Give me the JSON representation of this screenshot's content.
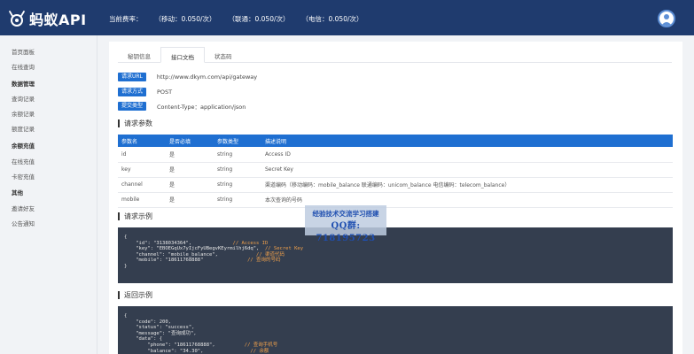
{
  "header": {
    "logo_text": "蚂蚁API",
    "rates": [
      {
        "label": "当前费率：",
        "value": ""
      },
      {
        "label": "（移动：0.050/次）",
        "value": ""
      },
      {
        "label": "（联通：0.050/次）",
        "value": ""
      },
      {
        "label": "（电信：0.050/次）",
        "value": ""
      }
    ],
    "avatar_icon": "user-avatar-icon"
  },
  "sidebar": {
    "items": [
      {
        "label": "首页面板",
        "group": false
      },
      {
        "label": "在线查询",
        "group": false
      },
      {
        "label": "数据管理",
        "group": true
      },
      {
        "label": "查询记录",
        "group": false
      },
      {
        "label": "余额记录",
        "group": false
      },
      {
        "label": "额度记录",
        "group": false
      },
      {
        "label": "余额充值",
        "group": true
      },
      {
        "label": "在线充值",
        "group": false
      },
      {
        "label": "卡密充值",
        "group": false
      },
      {
        "label": "其他",
        "group": true
      },
      {
        "label": "邀请好友",
        "group": false
      },
      {
        "label": "公告通知",
        "group": false
      }
    ]
  },
  "tabs": [
    {
      "label": "秘钥信息",
      "active": false
    },
    {
      "label": "接口文档",
      "active": true
    },
    {
      "label": "状态码",
      "active": false
    }
  ],
  "request_info": [
    {
      "badge": "请求URL",
      "value": "http://www.dkym.com/api/gateway"
    },
    {
      "badge": "请求方式",
      "value": "POST"
    },
    {
      "badge": "提交类型",
      "value": "Content-Type：application/json"
    }
  ],
  "sections": {
    "params_title": "请求参数",
    "example_title": "请求示例",
    "response_title": "返回示例"
  },
  "param_table": {
    "headers": [
      "参数名",
      "是否必填",
      "参数类型",
      "描述说明"
    ],
    "rows": [
      [
        "id",
        "是",
        "string",
        "Access ID"
      ],
      [
        "key",
        "是",
        "string",
        "Secret Key"
      ],
      [
        "channel",
        "是",
        "string",
        "渠道编码（移动编码：mobile_balance 联通编码：unicom_balance 电信编码：telecom_balance）"
      ],
      [
        "mobile",
        "是",
        "string",
        "本次查询的号码"
      ]
    ]
  },
  "request_example": [
    {
      "code": "{",
      "comment": ""
    },
    {
      "code": "    \"id\": \"3138034364\",",
      "comment": "// Access ID"
    },
    {
      "code": "    \"key\": \"EBOEGqUx7yIjcFyUBegvKEyrmilhj6dq\",",
      "comment": "// Secret Key"
    },
    {
      "code": "    \"channel\": \"mobile_balance\",",
      "comment": "// 渠道代码"
    },
    {
      "code": "    \"mobile\": \"18611768888\"",
      "comment": "// 查询的号码"
    },
    {
      "code": "}",
      "comment": ""
    }
  ],
  "response_example": [
    {
      "code": "{",
      "comment": ""
    },
    {
      "code": "    \"code\": 200,",
      "comment": ""
    },
    {
      "code": "    \"status\": \"success\",",
      "comment": ""
    },
    {
      "code": "    \"message\": \"查询成功\",",
      "comment": ""
    },
    {
      "code": "    \"data\": {",
      "comment": ""
    },
    {
      "code": "        \"phone\": \"18611768888\",",
      "comment": "// 查询手机号"
    },
    {
      "code": "        \"balance\": \"34.30\",",
      "comment": "// 余额"
    }
  ],
  "watermark": {
    "line1": "经验技术交流学习搭建",
    "line2": "QQ群: 718195723"
  },
  "colors": {
    "header_bg": "#1f3b6e",
    "accent": "#1f6fd1",
    "code_bg": "#343e4f",
    "comment": "#f0a04b"
  }
}
